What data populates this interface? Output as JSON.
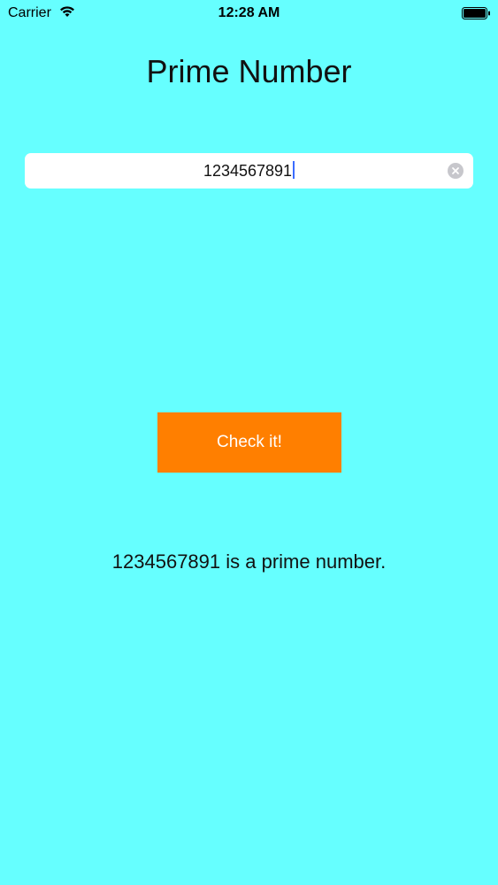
{
  "status_bar": {
    "carrier": "Carrier",
    "time": "12:28 AM",
    "wifi_icon": "wifi-icon",
    "battery_icon": "battery-icon"
  },
  "title": "Prime Number",
  "number_field": {
    "value": "1234567891",
    "clear_icon": "clear-icon"
  },
  "check_button": {
    "label": "Check it!"
  },
  "result": "1234567891 is a prime number.",
  "colors": {
    "background": "#66ffff",
    "button": "#ff7f00",
    "button_text": "#ffffff",
    "caret": "#3b6cff"
  }
}
